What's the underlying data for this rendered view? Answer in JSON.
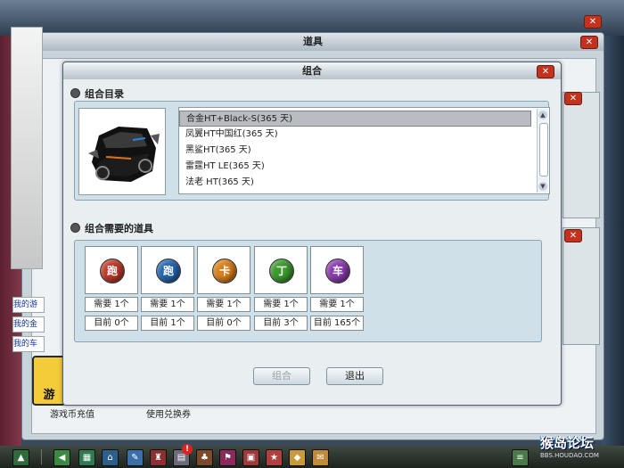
{
  "back_window": {
    "title": "道具",
    "side_links": [
      "我的游",
      "我的金",
      "我的车"
    ],
    "bottom_labels": [
      "游戏币充值",
      "使用兑换券"
    ],
    "game_icon_label": "游"
  },
  "dialog": {
    "title": "组合",
    "section_catalog": "组合目录",
    "catalog_items": [
      "合金HT+Black-S(365 天)",
      "凤翼HT中国红(365 天)",
      "黑鲨HT(365 天)",
      "雷霆HT LE(365 天)",
      "法老 HT(365 天)"
    ],
    "selected_index": 0,
    "section_required": "组合需要的道具",
    "required_items": [
      {
        "glyph": "跑",
        "color": "#c0392b",
        "need": "需要 1个",
        "current": "目前 0个"
      },
      {
        "glyph": "跑",
        "color": "#2566b0",
        "need": "需要 1个",
        "current": "目前 1个"
      },
      {
        "glyph": "卡",
        "color": "#d9801e",
        "need": "需要 1个",
        "current": "目前 0个"
      },
      {
        "glyph": "丁",
        "color": "#3c9a2e",
        "need": "需要 1个",
        "current": "目前 3个"
      },
      {
        "glyph": "车",
        "color": "#8b3db0",
        "need": "需要 1个",
        "current": "目前 165个"
      }
    ],
    "combine_button": "组合",
    "exit_button": "退出"
  },
  "watermark": {
    "main": "猴岛论坛",
    "sub": "BBS.HOUDAO.COM"
  },
  "colors": {
    "close": "#c2331f",
    "dialog_bg": "#e9eef1",
    "panel_bg": "#cfe0e8"
  }
}
